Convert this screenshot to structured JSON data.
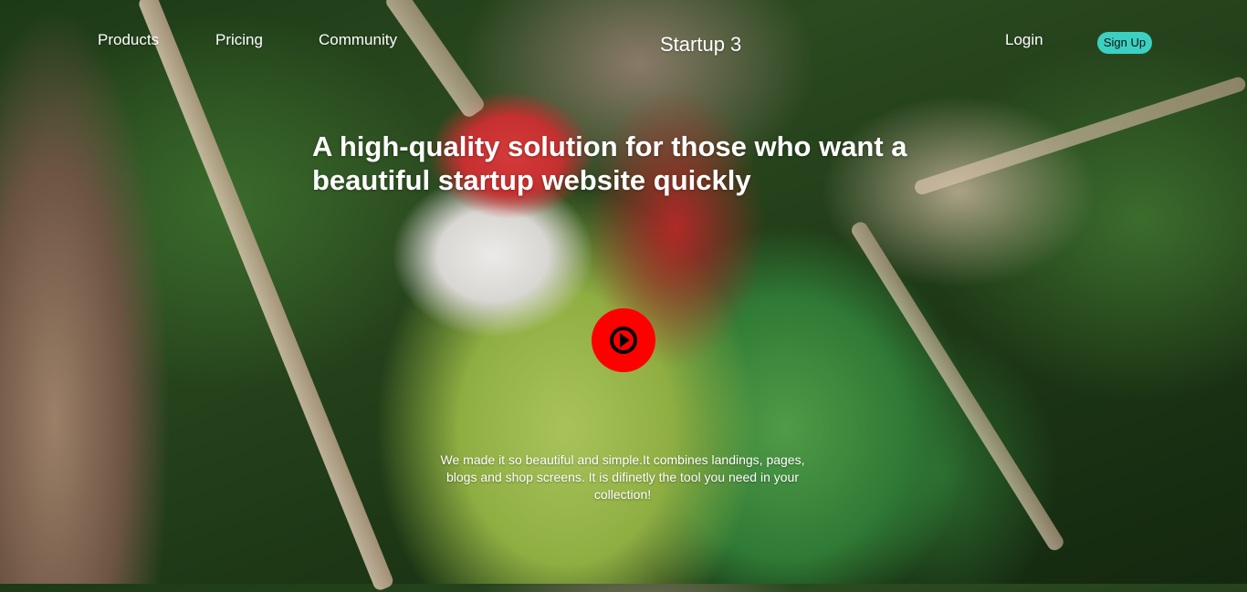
{
  "nav": {
    "products": "Products",
    "pricing": "Pricing",
    "community": "Community"
  },
  "brand": "Startup 3",
  "auth": {
    "login": "Login",
    "signup": "Sign Up"
  },
  "hero": {
    "headline": "A high-quality solution for those who want a beautiful startup website quickly",
    "description": "We made it so beautiful and simple.It combines landings, pages, blogs and shop screens. It is difinetly the tool you need in your collection!",
    "play_icon": "play-icon"
  },
  "colors": {
    "signup_bg": "#3cd0c2",
    "play_bg": "#ff0000",
    "text": "#ffffff"
  }
}
